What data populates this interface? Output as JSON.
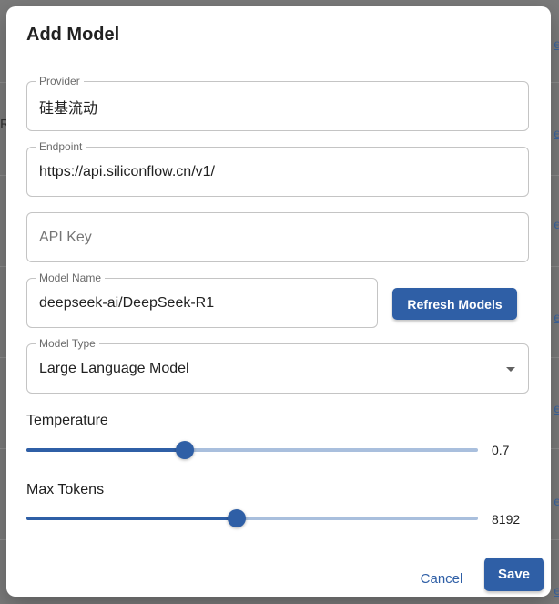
{
  "background": {
    "link_text": "e",
    "left_char": "R",
    "colors": {
      "overlay": "#7a7a7a",
      "link": "#2f5fa6"
    }
  },
  "dialog": {
    "title": "Add Model",
    "provider": {
      "label": "Provider",
      "value": "硅基流动"
    },
    "endpoint": {
      "label": "Endpoint",
      "value": "https://api.siliconflow.cn/v1/"
    },
    "api_key": {
      "placeholder": "API Key",
      "value": ""
    },
    "model_name": {
      "label": "Model Name",
      "value": "deepseek-ai/DeepSeek-R1"
    },
    "refresh_button": "Refresh Models",
    "model_type": {
      "label": "Model Type",
      "value": "Large Language Model"
    },
    "temperature": {
      "label": "Temperature",
      "value": "0.7",
      "fraction": 0.35
    },
    "max_tokens": {
      "label": "Max Tokens",
      "value": "8192",
      "fraction": 0.466
    },
    "cancel_button": "Cancel",
    "save_button": "Save",
    "colors": {
      "primary": "#2f5fa6",
      "rail": "#a9bfdd",
      "border": "#c4c4c4"
    },
    "icons": {
      "model_type_dropdown": "caret-down-icon"
    }
  }
}
